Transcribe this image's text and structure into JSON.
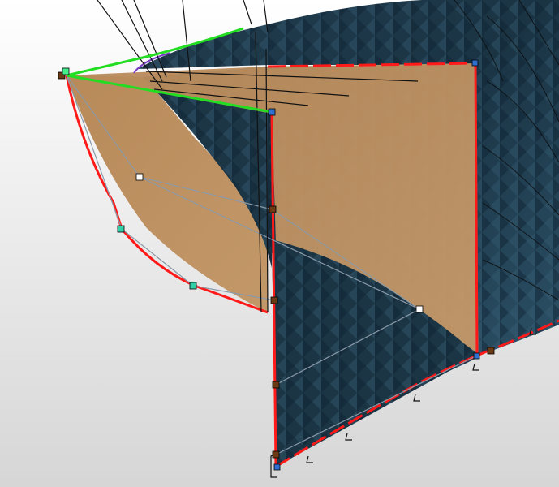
{
  "scene": {
    "viewport_label": "",
    "colors": {
      "background_top": "#ffffff",
      "background_bottom": "#d9d9d9",
      "hull_dark": "#17303f",
      "hull_mid": "#2a4b60",
      "patch_tan": "#b98d5f",
      "patch_tan_light": "#c79a69",
      "edge_red": "#ff1a1a",
      "control_green": "#22dd22",
      "control_poly_gray": "#8a9aa8",
      "wire_black": "#111111",
      "outline_purple": "#7a3cc8"
    },
    "icons": {
      "vertex_square_brown": "brown-square-handle-icon",
      "vertex_square_blue": "blue-square-handle-icon",
      "vertex_square_teal": "teal-square-handle-icon",
      "vertex_square_white": "white-square-handle-icon",
      "vertex_square_green": "green-square-handle-icon"
    }
  }
}
